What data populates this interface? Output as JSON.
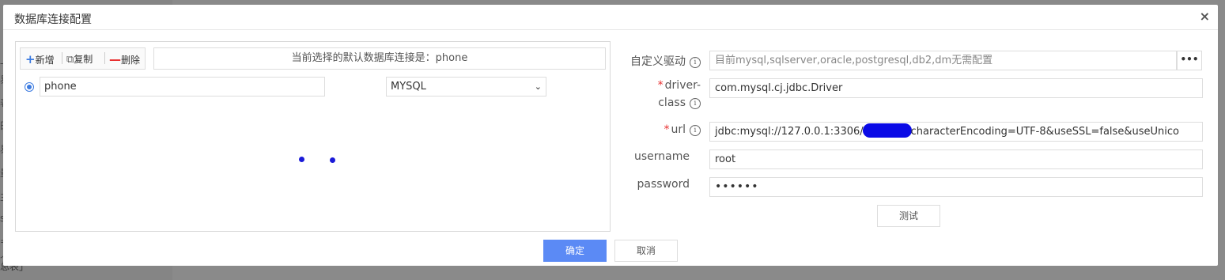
{
  "background": {
    "left_edge_chars": [
      "一",
      "易",
      "表",
      "田",
      "易",
      "量",
      "主",
      "s",
      "=",
      "个"
    ],
    "bottom_text": "总表」"
  },
  "dialog": {
    "title": "数据库连接配置",
    "close_glyph": "×"
  },
  "toolbar": {
    "add_label": "新增",
    "copy_label": "复制",
    "delete_label": "删除",
    "default_conn_text": "当前选择的默认数据库连接是：phone"
  },
  "connection": {
    "name": "phone",
    "db_type": "MYSQL"
  },
  "form": {
    "driver_label": "自定义驱动",
    "driver_placeholder": "目前mysql,sqlserver,oracle,postgresql,db2,dm无需配置",
    "more_glyph": "•••",
    "driver_class_label_1": "driver-",
    "driver_class_label_2": "class",
    "driver_class_value": "com.mysql.cj.jdbc.Driver",
    "url_label": "url",
    "url_value_prefix": "jdbc:mysql://127.0.0.1:3306/",
    "url_value_suffix": "characterEncoding=UTF-8&useSSL=false&useUnico",
    "username_label": "username",
    "username_value": "root",
    "password_label": "password",
    "password_value": "••••••",
    "required_mark": "*",
    "info_glyph": "i"
  },
  "buttons": {
    "test_label": "测试",
    "ok_label": "确定",
    "cancel_label": "取消"
  },
  "colors": {
    "primary": "#5b8af5",
    "required": "#e83030",
    "redaction": "#0a0ae6"
  }
}
